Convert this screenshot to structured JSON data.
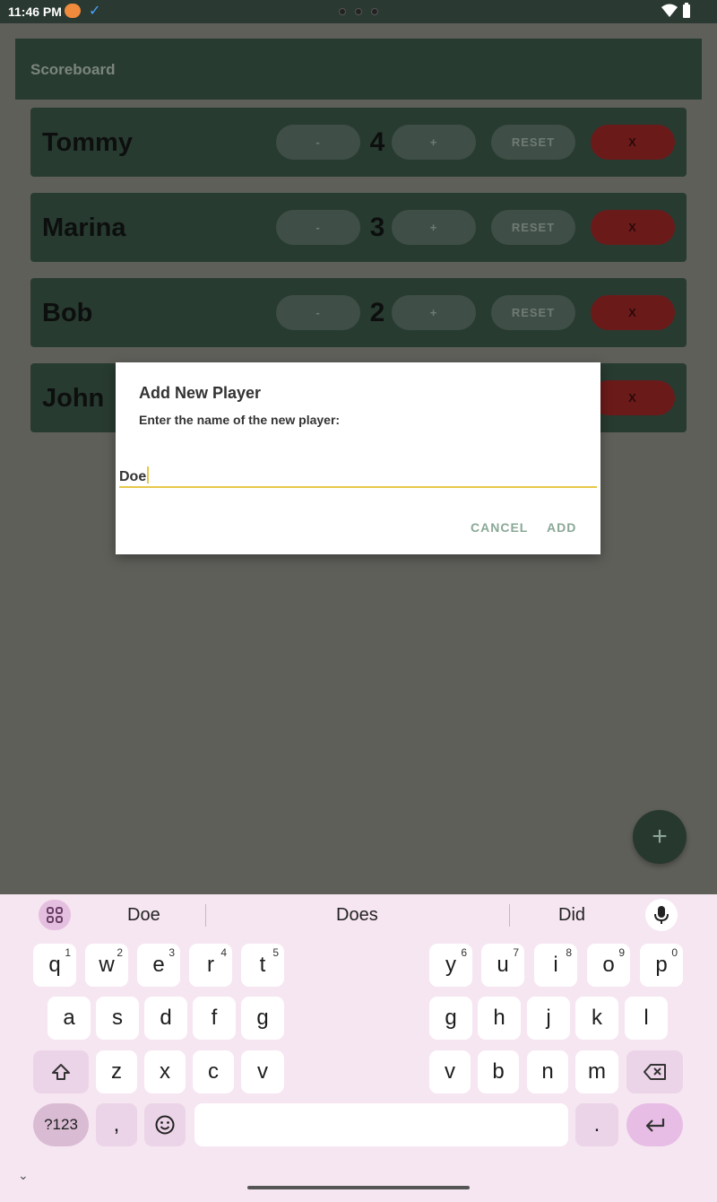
{
  "status_bar": {
    "time": "11:46 PM"
  },
  "app_bar": {
    "title": "Scoreboard"
  },
  "players": [
    {
      "name": "Tommy",
      "score": "4"
    },
    {
      "name": "Marina",
      "score": "3"
    },
    {
      "name": "Bob",
      "score": "2"
    },
    {
      "name": "John",
      "score": ""
    }
  ],
  "row_buttons": {
    "minus": "-",
    "plus": "+",
    "reset": "RESET",
    "remove": "X"
  },
  "dialog": {
    "title": "Add New Player",
    "message": "Enter the name of the new player:",
    "input_value": "Doe",
    "cancel_label": "CANCEL",
    "add_label": "ADD"
  },
  "fab": {
    "label": "+"
  },
  "keyboard": {
    "suggestions": [
      "Doe",
      "Does",
      "Did"
    ],
    "row1": [
      {
        "k": "q",
        "n": "1"
      },
      {
        "k": "w",
        "n": "2"
      },
      {
        "k": "e",
        "n": "3"
      },
      {
        "k": "r",
        "n": "4"
      },
      {
        "k": "t",
        "n": "5"
      },
      {
        "k": "y",
        "n": "6"
      },
      {
        "k": "u",
        "n": "7"
      },
      {
        "k": "i",
        "n": "8"
      },
      {
        "k": "o",
        "n": "9"
      },
      {
        "k": "p",
        "n": "0"
      }
    ],
    "row2": [
      "a",
      "s",
      "d",
      "f",
      "g",
      "g",
      "h",
      "j",
      "k",
      "l"
    ],
    "row3": [
      "z",
      "x",
      "c",
      "v",
      "v",
      "b",
      "n",
      "m"
    ],
    "symbols_label": "?123",
    "comma": ",",
    "period": "."
  },
  "colors": {
    "accent": "#e6c84a",
    "app_dark": "#283b31",
    "remove_red": "#6b1a1a"
  }
}
